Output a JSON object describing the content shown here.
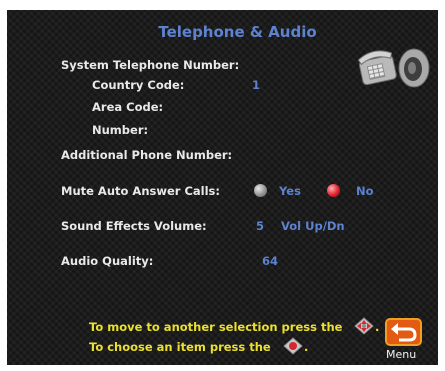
{
  "title": "Telephone & Audio",
  "system_phone": {
    "label": "System Telephone Number:",
    "country_code_label": "Country Code:",
    "country_code_value": "1",
    "area_code_label": "Area Code:",
    "number_label": "Number:"
  },
  "additional_phone": {
    "label": "Additional Phone Number:"
  },
  "mute_auto_answer": {
    "label": "Mute Auto Answer Calls:",
    "yes_label": "Yes",
    "no_label": "No",
    "selected": "No"
  },
  "sound_effects": {
    "label": "Sound Effects Volume:",
    "value": "5",
    "hint": "Vol Up/Dn"
  },
  "audio_quality": {
    "label": "Audio Quality:",
    "value": "64"
  },
  "instructions": {
    "line1": "To move to another selection press the",
    "line1_end": ".",
    "line2": "To choose an item press the",
    "line2_end": "."
  },
  "menu_button": {
    "label": "Menu"
  },
  "icons": {
    "header": "telephone-and-speaker-icon",
    "menu": "back-arrow-icon",
    "nav": "dpad-icon"
  },
  "colors": {
    "accent": "#5d82cf",
    "hint": "#ece02e",
    "selected_radio": "#e2222f",
    "background": "#161616"
  }
}
